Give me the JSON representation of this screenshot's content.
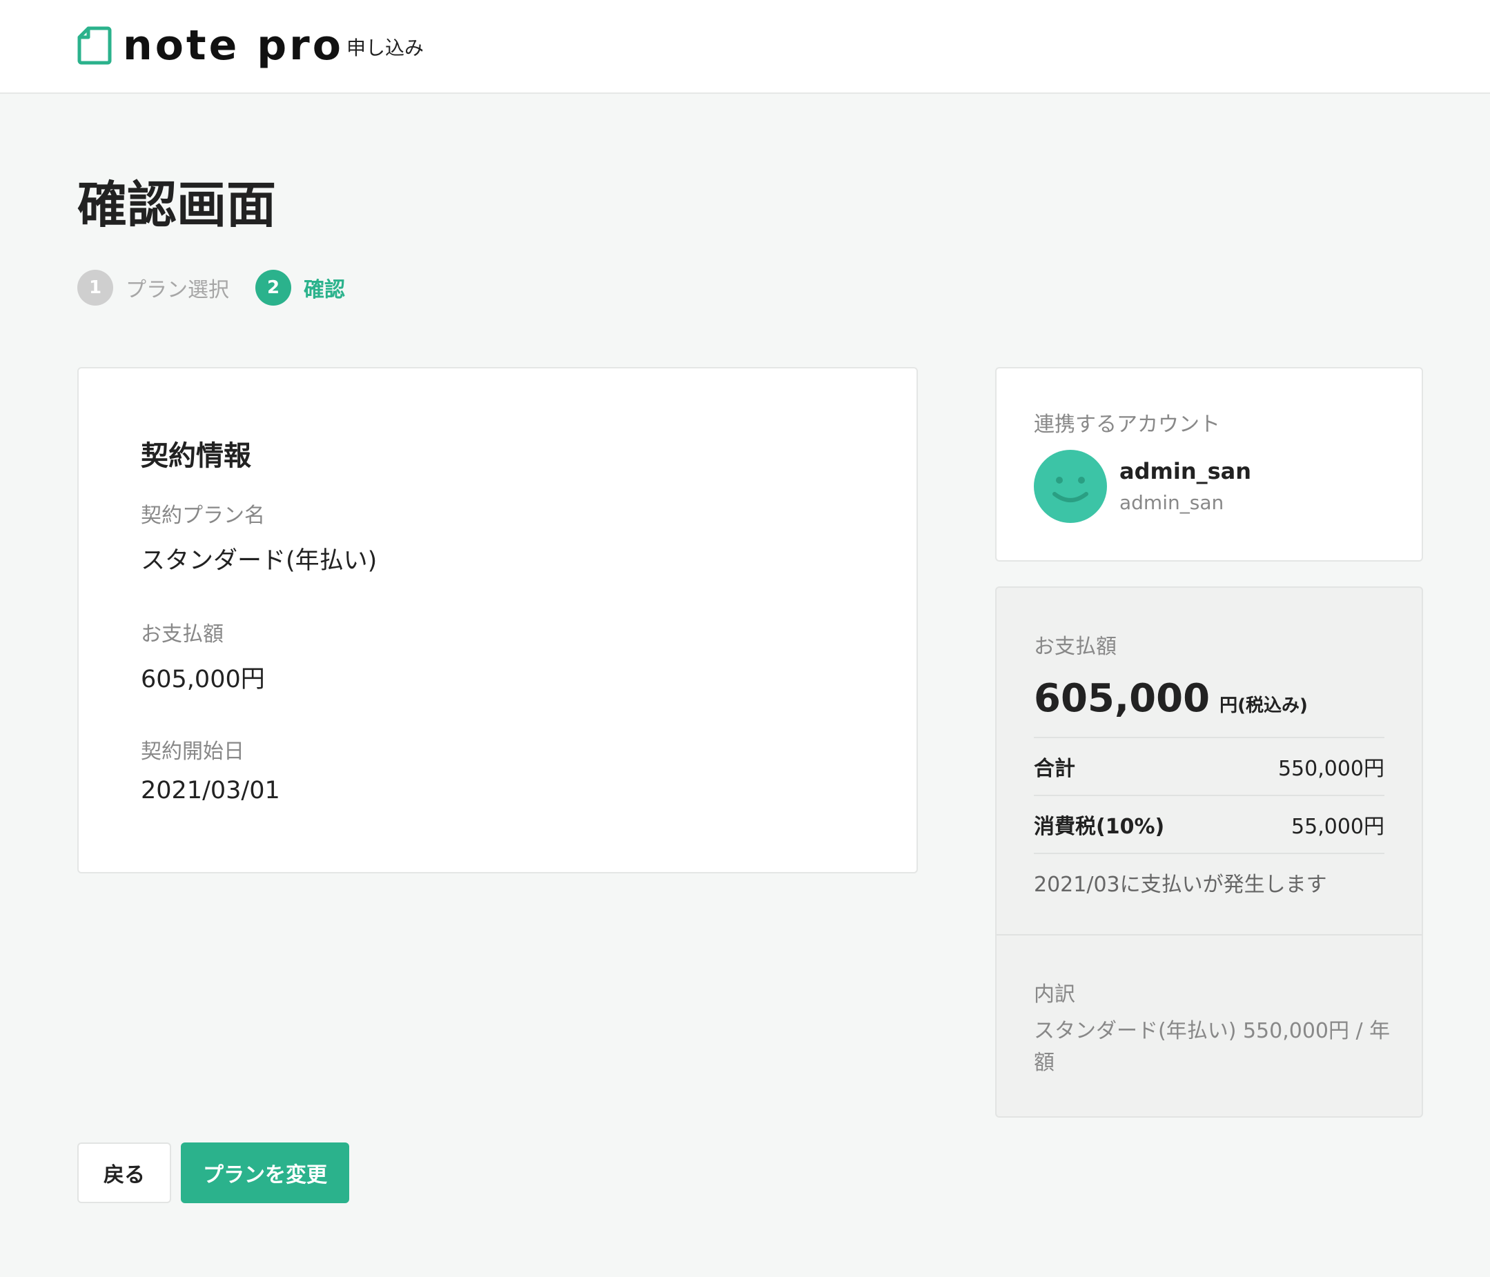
{
  "header": {
    "logo_text": "note pro",
    "subtitle": "申し込み"
  },
  "page": {
    "title": "確認画面"
  },
  "steps": [
    {
      "number": "1",
      "label": "プラン選択",
      "active": false
    },
    {
      "number": "2",
      "label": "確認",
      "active": true
    }
  ],
  "contract": {
    "title": "契約情報",
    "fields": [
      {
        "label": "契約プラン名",
        "value": "スタンダード(年払い)"
      },
      {
        "label": "お支払額",
        "value": "605,000円"
      },
      {
        "label": "契約開始日",
        "value": "2021/03/01"
      }
    ]
  },
  "account": {
    "heading": "連携するアカウント",
    "display_name": "admin_san",
    "user_id": "admin_san",
    "avatar_color": "#3cc4a6",
    "avatar_icon": "smiley-face"
  },
  "payment": {
    "heading": "お支払額",
    "amount": "605,000",
    "unit": "円(税込み)",
    "rows": [
      {
        "label": "合計",
        "value": "550,000円"
      },
      {
        "label": "消費税(10%)",
        "value": "55,000円"
      }
    ],
    "note": "2021/03に支払いが発生します",
    "breakdown_heading": "内訳",
    "breakdown_text": "スタンダード(年払い) 550,000円 / 年額"
  },
  "buttons": {
    "back_label": "戻る",
    "change_label": "プランを変更"
  },
  "colors": {
    "accent": "#2bb28c",
    "background": "#f5f7f6",
    "inactive_step": "#cfcfcf"
  }
}
